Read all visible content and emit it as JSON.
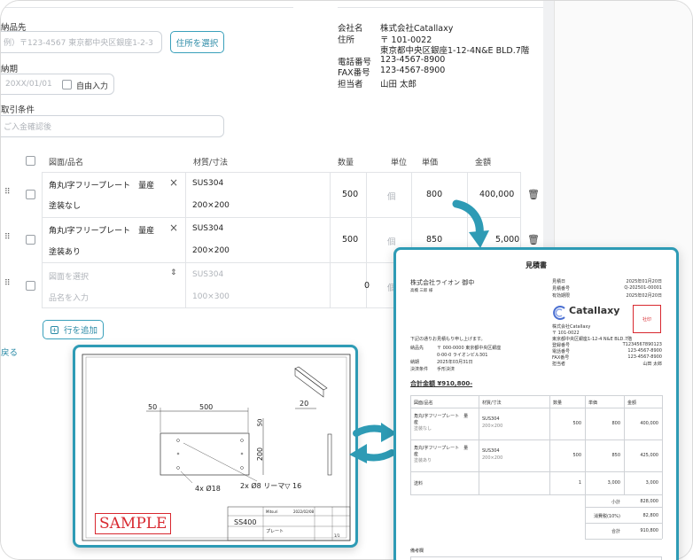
{
  "form": {
    "delivery_label": "納品先",
    "delivery_placeholder": "例）〒123-4567 東京都中央区銀座1-2-3",
    "select_address": "住所を選択",
    "deadline_label": "納期",
    "deadline_placeholder": "20XX/01/01",
    "free_input": "自由入力",
    "terms_label": "取引条件",
    "terms_placeholder": "ご入金確認後"
  },
  "company": {
    "rows": [
      {
        "k": "会社名",
        "v": "株式会社Catallaxy"
      },
      {
        "k": "住所",
        "v": "〒 101-0022"
      },
      {
        "k": "",
        "v": "東京都中央区銀座1-12-4N&E BLD.7階"
      },
      {
        "k": "電話番号",
        "v": "123-4567-8900"
      },
      {
        "k": "FAX番号",
        "v": "123-4567-8900"
      },
      {
        "k": "担当者",
        "v": "山田 太郎"
      }
    ]
  },
  "table": {
    "headers": {
      "name": "図面/品名",
      "material": "材質/寸法",
      "qty": "数量",
      "unit": "単位",
      "price": "単価",
      "amount": "金額"
    },
    "rows": [
      {
        "name": "角丸I字フリープレート　量産",
        "sub": "塗装なし",
        "material": "SUS304",
        "size": "200×200",
        "qty": "500",
        "unit": "個",
        "price": "800",
        "amount": "400,000"
      },
      {
        "name": "角丸I字フリープレート　量産",
        "sub": "塗装あり",
        "material": "SUS304",
        "size": "200×200",
        "qty": "500",
        "unit": "個",
        "price": "850",
        "amount": "425,000"
      },
      {
        "name": "図面を選択",
        "sub": "品名を入力",
        "material": "SUS304",
        "size": "100×300",
        "qty": "0",
        "unit": "個",
        "price": "",
        "amount": ""
      }
    ],
    "add_row": "行を追加",
    "back": "戻る",
    "amount_partial": "5,000"
  },
  "drawing": {
    "dims": [
      "50",
      "500",
      "20",
      "50",
      "200"
    ],
    "hole1": "4x Ø18",
    "hole2": "2x Ø8 リーマ▽ 16",
    "sample": "SAMPLE",
    "title_block": {
      "material": "SS400",
      "name": "プレート",
      "maker": "Mitsuri",
      "date": "2022/02/08",
      "scale": "1/1"
    }
  },
  "estimate": {
    "title": "見積書",
    "customer": "株式会社ライオン 御中",
    "customer_person": "高橋 三郎 様",
    "meta": [
      {
        "k": "見積日",
        "v": "2025年01月20日"
      },
      {
        "k": "見積番号",
        "v": "Q-202501-00001"
      },
      {
        "k": "有効期限",
        "v": "2025年02月20日"
      }
    ],
    "brand": "Catallaxy",
    "stamp": "社印",
    "issuer": [
      {
        "k": "株式会社Catallaxy",
        "v": ""
      },
      {
        "k": "〒 101-0022",
        "v": ""
      },
      {
        "k": "東京都中央区銀座1-12-4 N&E BLD.7階",
        "v": ""
      },
      {
        "k": "登録番号",
        "v": "T1234567890123"
      },
      {
        "k": "電話番号",
        "v": "123-4567-8900"
      },
      {
        "k": "FAX番号",
        "v": "123-4567-8900"
      },
      {
        "k": "担当者",
        "v": "山田 太郎"
      }
    ],
    "intro": "下記の通りお見積もり申し上げます。",
    "details": [
      {
        "k": "納品先",
        "v": "〒 000-0000 東京都中央区銀座"
      },
      {
        "k": "",
        "v": "0-00-0 ライオンビル301"
      },
      {
        "k": "納期",
        "v": "2025年03月31日"
      },
      {
        "k": "決済条件",
        "v": "手形決済"
      }
    ],
    "total": "合計金額 ¥910,800-",
    "headers": [
      "図面/品名",
      "材質/寸法",
      "数量",
      "単価",
      "金額"
    ],
    "rows": [
      {
        "name": "角丸I字フリープレート　量",
        "name2": "産",
        "sub": "塗装なし",
        "mat": "SUS304",
        "size": "200×200",
        "qty": "500",
        "price": "800",
        "amount": "400,000"
      },
      {
        "name": "角丸I字フリープレート　量",
        "name2": "産",
        "sub": "塗装あり",
        "mat": "SUS304",
        "size": "200×200",
        "qty": "500",
        "price": "850",
        "amount": "425,000"
      },
      {
        "name": "送料",
        "name2": "",
        "sub": "",
        "mat": "",
        "size": "",
        "qty": "1",
        "price": "3,000",
        "amount": "3,000"
      }
    ],
    "summary": [
      {
        "k": "小計",
        "v": "828,000"
      },
      {
        "k": "消費税(10%)",
        "v": "82,800"
      },
      {
        "k": "合計",
        "v": "910,800"
      }
    ],
    "remarks": "備考欄"
  }
}
